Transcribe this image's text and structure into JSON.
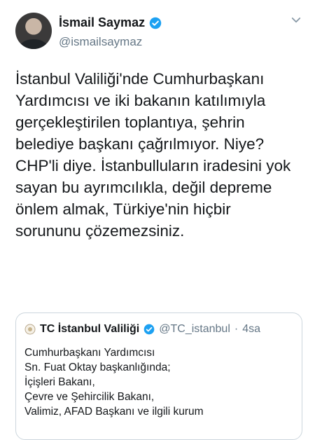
{
  "author": {
    "name": "İsmail Saymaz",
    "handle": "@ismailsaymaz",
    "verified_color": "#1da1f2"
  },
  "tweet": {
    "lines": [
      "İstanbul Valiliği'nde Cumhurbaşkanı",
      "Yardımcısı ve iki bakanın katılımıyla",
      "gerçekleştirilen toplantıya, şehrin",
      "belediye başkanı çağrılmıyor. Niye?",
      "CHP'li diye. İstanbulluların iradesini yok",
      "sayan bu ayrımcılıkla, değil depreme",
      "önlem almak, Türkiye'nin hiçbir",
      "sorununu çözemezsiniz."
    ]
  },
  "quoted": {
    "name": "TC İstanbul Valiliği",
    "handle": "@TC_istanbul",
    "separator": "·",
    "time": "4sa",
    "lines": [
      "Cumhurbaşkanı Yardımcısı",
      "Sn. Fuat Oktay başkanlığında;",
      "İçişleri Bakanı,",
      "Çevre ve Şehircilik Bakanı,",
      "Valimiz, AFAD Başkanı ve ilgili kurum"
    ]
  },
  "icons": {
    "avatar": "profile-photo",
    "verified": "verified-badge-icon",
    "more": "chevron-down-icon",
    "quoted_logo": "tc-crest-icon"
  }
}
